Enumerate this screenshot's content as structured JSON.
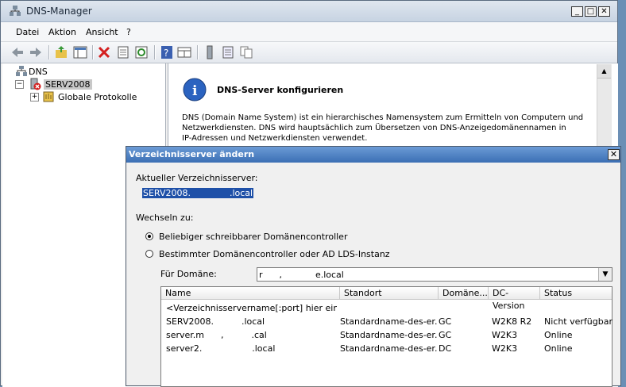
{
  "window": {
    "title": "DNS-Manager"
  },
  "menu": [
    "Datei",
    "Aktion",
    "Ansicht",
    "?"
  ],
  "toolbar": {
    "icons": [
      "back-icon",
      "forward-icon",
      "up-folder-icon",
      "console-tree-icon",
      "delete-icon",
      "properties-icon",
      "refresh-icon",
      "help-icon",
      "view-icon",
      "server-icon",
      "zone-icon",
      "copy-icon"
    ]
  },
  "tree": {
    "root": "DNS",
    "server": "SERV2008",
    "child": "Globale Protokolle"
  },
  "right": {
    "heading": "DNS-Server konfigurieren",
    "line1": "DNS (Domain Name System) ist ein hierarchisches Namensystem zum Ermitteln von Computern und",
    "line2": "Netzwerkdiensten. DNS wird hauptsächlich zum Übersetzen von DNS-Anzeigedomänennamen in",
    "line3": "IP-Adressen und Netzwerkdiensten verwendet."
  },
  "dialog": {
    "title": "Verzeichnisserver ändern",
    "current_label": "Aktueller Verzeichnisserver:",
    "current_value": "SERV2008.              .local",
    "switch_label": "Wechseln zu:",
    "option1": "Beliebiger schreibbarer Domänencontroller",
    "option2": "Bestimmter Domänencontroller oder AD LDS-Instanz",
    "domain_label": "Für Domäne:",
    "domain_value": "r      ,            e.local",
    "columns": [
      "Name",
      "Standort",
      "Domäne...",
      "DC-Version",
      "Status"
    ],
    "rows": [
      [
        "<Verzeichnisservername[:port] hier eingeb...",
        "",
        "",
        "",
        ""
      ],
      [
        "SERV2008.          .local",
        "Standardname-des-er...",
        "GC",
        "W2K8 R2",
        "Nicht verfügbar"
      ],
      [
        "server.m      ,          .cal",
        "Standardname-des-er...",
        "GC",
        "W2K3",
        "Online"
      ],
      [
        "server2.                  .local",
        "Standardname-des-er...",
        "DC",
        "W2K3",
        "Online"
      ]
    ]
  }
}
